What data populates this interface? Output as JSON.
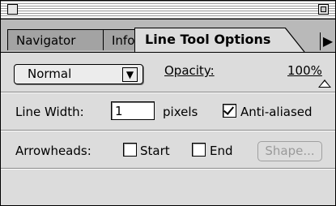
{
  "tabs": [
    {
      "label": "Navigator"
    },
    {
      "label": "Info"
    },
    {
      "label": "Line Tool Options"
    }
  ],
  "blend_mode": {
    "selected": "Normal"
  },
  "opacity": {
    "label": "Opacity:",
    "value_text": "100%",
    "value": 100
  },
  "line_width": {
    "label": "Line Width:",
    "value": "1",
    "units": "pixels"
  },
  "anti_aliased": {
    "label": "Anti-aliased",
    "checked": true
  },
  "arrowheads": {
    "label": "Arrowheads:",
    "start_label": "Start",
    "start_checked": false,
    "end_label": "End",
    "end_checked": false,
    "shape_button": "Shape..."
  }
}
